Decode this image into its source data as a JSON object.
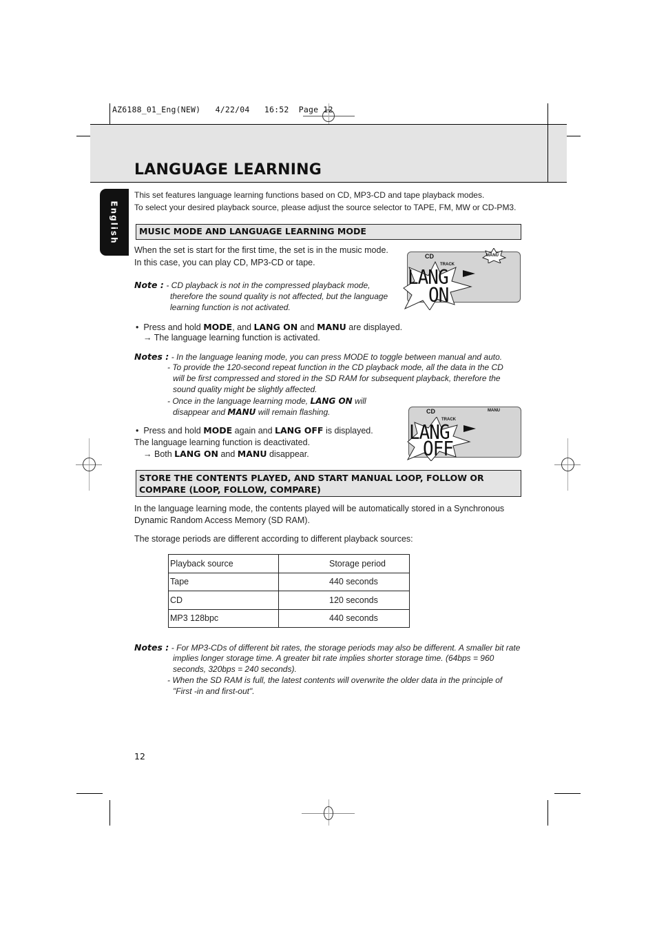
{
  "slug": {
    "file": "AZ6188_01_Eng(NEW)",
    "date": "4/22/04",
    "time": "16:52",
    "page_label": "Page 12"
  },
  "header": {
    "title": "LANGUAGE LEARNING",
    "side_tab": "English"
  },
  "intro": {
    "line1": "This set features language learning functions based on CD, MP3-CD and tape playback modes.",
    "line2": "To select your desired playback source, please adjust the source selector to TAPE, FM, MW or CD-PM3."
  },
  "section1": {
    "heading": "MUSIC MODE AND LANGUAGE LEARNING MODE",
    "para1_line1": "When the set is start for the first time, the set is in the music mode.",
    "para1_line2": "In this case, you can play CD, MP3-CD or tape.",
    "note_label": "Note :",
    "note_line1": "- CD playback is not in the compressed playback mode,",
    "note_line2": "therefore the sound quality is not affected, but the language",
    "note_line3": "learning function is not activated.",
    "step1": {
      "bullet": "•",
      "pre": "Press and hold ",
      "kw1": "MODE",
      "mid1": ", and ",
      "kw2": "LANG ON",
      "mid2": " and ",
      "kw3": "MANU",
      "post": " are displayed.",
      "arrow": "→",
      "result": "The language learning function is activated."
    },
    "notes_label": "Notes :",
    "notes": {
      "n1": "- In the language leaning mode, you can press MODE to toggle between manual and auto.",
      "n2_line1": "- To provide the 120-second repeat function in the CD playback mode, all the data in the CD",
      "n2_line2": "will be first compressed and stored in the SD RAM for subsequent playback, therefore the",
      "n2_line3": "sound quality might be slightly affected.",
      "n3_pre": "- Once in the language learning mode, ",
      "n3_kw1": "LANG ON",
      "n3_mid": " will",
      "n3_line2_pre": "disappear and ",
      "n3_kw2": "MANU",
      "n3_post": " will remain flashing."
    },
    "step2": {
      "bullet": "•",
      "pre": "Press and hold ",
      "kw1": "MODE",
      "mid": " again and ",
      "kw2": "LANG OFF",
      "post": " is displayed.",
      "line2": "The language learning function is deactivated.",
      "arrow": "→",
      "res_pre": "Both ",
      "res_kw1": "LANG ON",
      "res_mid": " and ",
      "res_kw2": "MANU",
      "res_post": " disappear."
    }
  },
  "display1": {
    "source": "CD",
    "track": "TRACK",
    "mode_indicator": "MANU",
    "line1": "LANG",
    "line2": "ON",
    "play_icon": "play-icon"
  },
  "display2": {
    "source": "CD",
    "track": "TRACK",
    "mode_indicator": "MANU",
    "line1": "LANG",
    "line2": "OFF",
    "play_icon": "play-icon"
  },
  "section2": {
    "heading_line1": "STORE THE CONTENTS PLAYED, AND START MANUAL LOOP, FOLLOW OR",
    "heading_line2": "COMPARE (LOOP, FOLLOW, COMPARE)",
    "para1_line1": "In the language learning mode, the contents played will be automatically stored in a Synchronous",
    "para1_line2": "Dynamic Random Access Memory (SD RAM).",
    "para2": "The storage periods are different according to different playback sources:",
    "table": {
      "headers": [
        "Playback source",
        "Storage period"
      ],
      "rows": [
        [
          "Tape",
          "440 seconds"
        ],
        [
          "CD",
          "120 seconds"
        ],
        [
          "MP3 128bpc",
          "440 seconds"
        ]
      ]
    },
    "notes_label": "Notes :",
    "n1_line1": "- For MP3-CDs of different bit rates, the storage periods may also be different. A smaller bit rate",
    "n1_line2": "implies longer storage time. A greater bit rate implies shorter storage time. (64bps = 960",
    "n1_line3": "seconds, 320bps = 240 seconds).",
    "n2_line1": "- When the SD RAM is full, the latest contents will overwrite the older data in the principle of",
    "n2_line2": "\"First -in and first-out\"."
  },
  "footer": {
    "page_number": "12"
  }
}
